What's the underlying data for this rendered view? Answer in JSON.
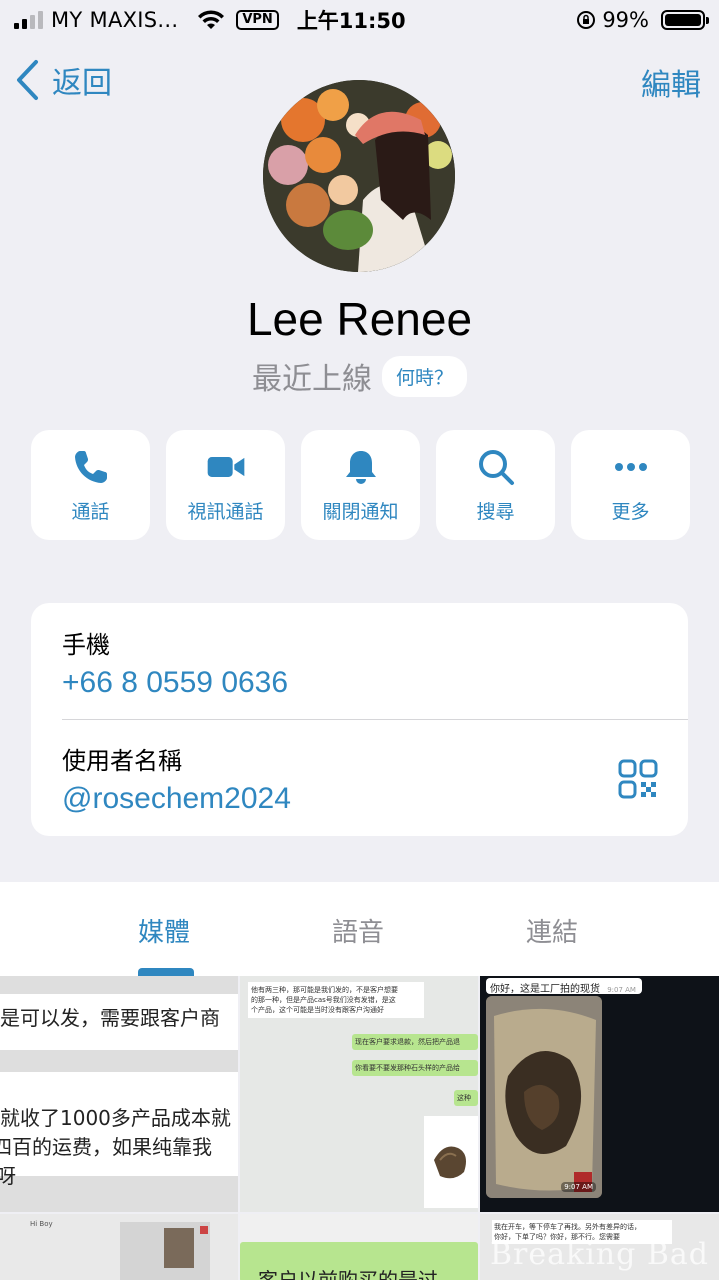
{
  "status_bar": {
    "carrier": "MY MAXIS...",
    "vpn": "VPN",
    "time": "上午11:50",
    "battery": "99%"
  },
  "nav": {
    "back_label": "返回",
    "edit_label": "編輯"
  },
  "profile": {
    "name": "Lee Renee",
    "last_seen": "最近上線",
    "when_button": "何時？"
  },
  "actions": [
    {
      "label": "通話",
      "icon": "phone-icon"
    },
    {
      "label": "視訊通話",
      "icon": "video-icon"
    },
    {
      "label": "關閉通知",
      "icon": "bell-icon"
    },
    {
      "label": "搜尋",
      "icon": "search-icon"
    },
    {
      "label": "更多",
      "icon": "more-icon"
    }
  ],
  "info": {
    "phone_label": "手機",
    "phone_value": "+66 8 0559 0636",
    "username_label": "使用者名稱",
    "username_value": "@rosechem2024",
    "qr_icon": "qr-code-icon"
  },
  "tabs": [
    {
      "label": "媒體",
      "active": true
    },
    {
      "label": "語音",
      "active": false
    },
    {
      "label": "連結",
      "active": false
    }
  ],
  "media": {
    "cell1_lines": [
      "是可以发，需要跟客户商",
      "就收了1000多产品成本就",
      "四百的运费，如果纯靠我",
      "呀"
    ],
    "cell2_lines": [
      "他有两三种，那可能是我们发的，不是客户想要",
      "的那一种，但是产品cas号我们没有发错，是这",
      "个产品，这个可能是当时没有跟客户沟通好",
      "现在客户要求退款，然后把产品退",
      "你看要不要发那种石头样的产品给",
      "这种"
    ],
    "cell3_caption": "你好，这是工厂拍的现货",
    "cell3_time": "9:07 AM",
    "cell3_time2": "9:07 AM",
    "cell5_line": "客户以前购买的是过",
    "cell4_line": "Hi Boy",
    "cell6_lines": [
      "我在开车，等下停车了再找。另外有差异的话，",
      "你好，下单了吗？你好，那不行。您需要"
    ],
    "watermark": "Breaking Bad"
  },
  "colors": {
    "accent": "#2f87c0",
    "background": "#efeff4",
    "muted": "#8e8e93"
  }
}
